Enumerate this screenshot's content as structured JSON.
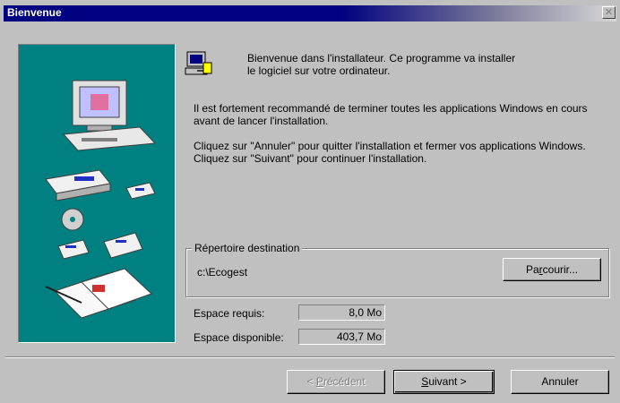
{
  "window": {
    "title": "Bienvenue",
    "close_glyph": "✕"
  },
  "intro": {
    "line1": "Bienvenue dans l'installateur. Ce programme va installer",
    "line2": "le logiciel sur votre ordinateur.",
    "warning": "Il est fortement recommandé de terminer toutes les applications Windows en cours avant de lancer l'installation.",
    "cancel_hint": "Cliquez sur \"Annuler\" pour quitter l'installation et fermer vos applications Windows.",
    "next_hint": "Cliquez sur \"Suivant\" pour continuer l'installation."
  },
  "destination": {
    "legend": "Répertoire destination",
    "path": "c:\\Ecogest",
    "browse_pre": "Pa",
    "browse_key": "r",
    "browse_post": "courir..."
  },
  "space": {
    "required_label": "Espace requis:",
    "required_value": "8,0 Mo",
    "available_label": "Espace disponible:",
    "available_value": "403,7 Mo"
  },
  "buttons": {
    "prev_pre": "< ",
    "prev_key": "P",
    "prev_post": "récédent",
    "next_key": "S",
    "next_post": "uivant >",
    "cancel": "Annuler"
  },
  "icons": {
    "computer": "computer-icon",
    "setup_art": "setup-illustration"
  },
  "colors": {
    "title_bar": "#000080",
    "art_background": "#008080",
    "dialog_face": "#c0c0c0"
  }
}
